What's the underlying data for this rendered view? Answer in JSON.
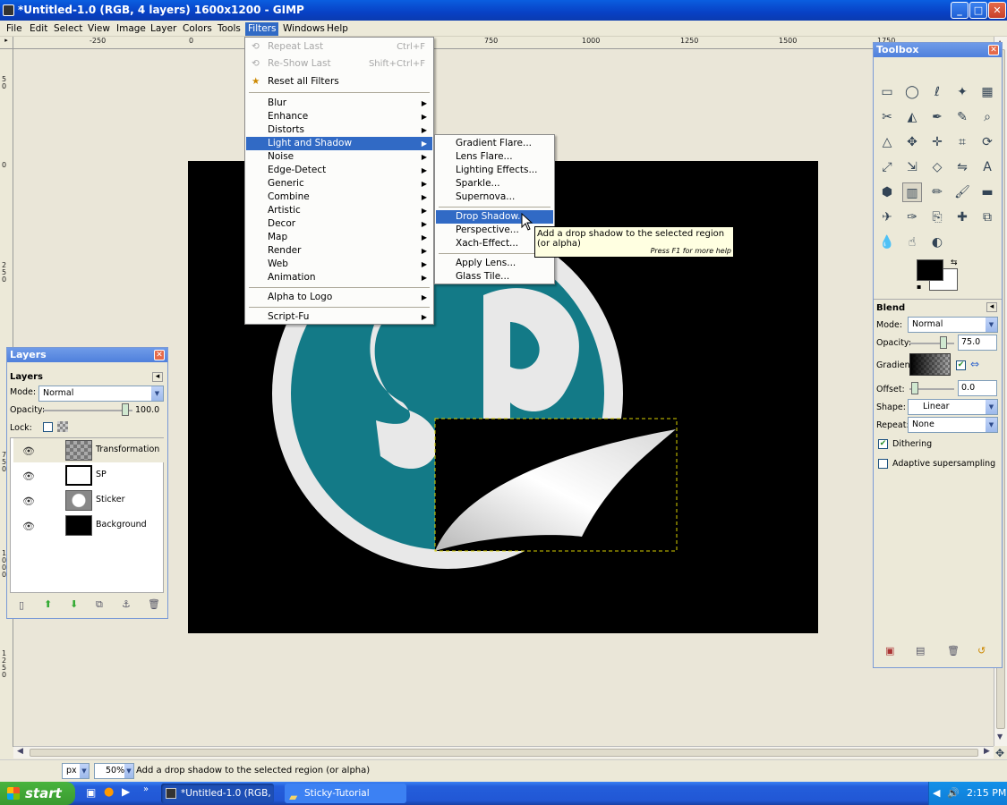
{
  "window": {
    "title": "*Untitled-1.0 (RGB, 4 layers) 1600x1200 - GIMP",
    "minimize": "_",
    "maximize": "□",
    "close": "✕"
  },
  "menubar": [
    "File",
    "Edit",
    "Select",
    "View",
    "Image",
    "Layer",
    "Colors",
    "Tools",
    "Filters",
    "Windows",
    "Help"
  ],
  "rulers": {
    "top": [
      {
        "label": "-250"
      },
      {
        "label": "0"
      },
      {
        "label": "750"
      },
      {
        "label": "1000"
      },
      {
        "label": "1250"
      },
      {
        "label": "1500"
      },
      {
        "label": "1750"
      }
    ],
    "left": [
      {
        "label": "5 0"
      },
      {
        "label": "0"
      },
      {
        "label": "2 5 0"
      },
      {
        "label": "7 5 0"
      },
      {
        "label": "1 0 0 0"
      },
      {
        "label": "1 2 5 0"
      }
    ]
  },
  "filters_menu": {
    "items": [
      {
        "label": "Repeat Last",
        "accel": "Ctrl+F",
        "disabled": true,
        "icon": "repeat-icon"
      },
      {
        "label": "Re-Show Last",
        "accel": "Shift+Ctrl+F",
        "disabled": true,
        "icon": "reshow-icon"
      },
      {
        "label": "Reset all Filters",
        "icon": "reset-icon"
      },
      {
        "label": "Blur",
        "sub": true
      },
      {
        "label": "Enhance",
        "sub": true
      },
      {
        "label": "Distorts",
        "sub": true
      },
      {
        "label": "Light and Shadow",
        "sub": true,
        "highlighted": true
      },
      {
        "label": "Noise",
        "sub": true
      },
      {
        "label": "Edge-Detect",
        "sub": true
      },
      {
        "label": "Generic",
        "sub": true
      },
      {
        "label": "Combine",
        "sub": true
      },
      {
        "label": "Artistic",
        "sub": true
      },
      {
        "label": "Decor",
        "sub": true
      },
      {
        "label": "Map",
        "sub": true
      },
      {
        "label": "Render",
        "sub": true
      },
      {
        "label": "Web",
        "sub": true
      },
      {
        "label": "Animation",
        "sub": true
      },
      {
        "label": "Alpha to Logo",
        "sub": true
      },
      {
        "label": "Script-Fu",
        "sub": true
      }
    ]
  },
  "light_shadow_menu": {
    "items": [
      {
        "label": "Gradient Flare..."
      },
      {
        "label": "Lens Flare..."
      },
      {
        "label": "Lighting Effects..."
      },
      {
        "label": "Sparkle..."
      },
      {
        "label": "Supernova..."
      },
      {
        "label": "Drop Shadow...",
        "highlighted": true
      },
      {
        "label": "Perspective..."
      },
      {
        "label": "Xach-Effect..."
      },
      {
        "label": "Apply Lens..."
      },
      {
        "label": "Glass Tile..."
      }
    ]
  },
  "tooltip": {
    "text": "Add a drop shadow to the selected region (or alpha)",
    "hint": "Press F1 for more help"
  },
  "layers_dock": {
    "title": "Layers",
    "tab_label": "Layers",
    "mode_label": "Mode:",
    "mode_value": "Normal",
    "opacity_label": "Opacity:",
    "opacity_value": "100.0",
    "lock_label": "Lock:",
    "layers": [
      {
        "name": "Transformation",
        "selected": true
      },
      {
        "name": "SP"
      },
      {
        "name": "Sticker"
      },
      {
        "name": "Background"
      }
    ],
    "buttons": [
      "new-layer-icon",
      "raise-layer-icon",
      "lower-layer-icon",
      "duplicate-layer-icon",
      "anchor-layer-icon",
      "delete-layer-icon"
    ]
  },
  "toolbox": {
    "title": "Toolbox",
    "tools": [
      "rect-select-icon",
      "ellipse-select-icon",
      "free-select-icon",
      "fuzzy-select-icon",
      "color-select-icon",
      "scissors-icon",
      "foreground-select-icon",
      "paths-icon",
      "color-picker-icon",
      "zoom-icon",
      "measure-icon",
      "move-icon",
      "align-icon",
      "crop-icon",
      "rotate-icon",
      "scale-icon",
      "shear-icon",
      "perspective-icon",
      "flip-icon",
      "text-icon",
      "bucket-fill-icon",
      "blend-icon",
      "pencil-icon",
      "paintbrush-icon",
      "eraser-icon",
      "airbrush-icon",
      "ink-icon",
      "clone-icon",
      "heal-icon",
      "perspective-clone-icon",
      "blur-icon",
      "smudge-icon",
      "dodge-burn-icon"
    ],
    "tool_glyphs": [
      "▭",
      "◯",
      "ℓ",
      "✦",
      "▦",
      "✂",
      "◭",
      "✒",
      "✎",
      "⌕",
      "△",
      "✥",
      "✛",
      "⌗",
      "⟳",
      "⤢",
      "⇲",
      "◇",
      "⇋",
      "A",
      "⬢",
      "▥",
      "✏",
      "🖌",
      "▬",
      "✈",
      "✑",
      "⎘",
      "✚",
      "⧉",
      "💧",
      "☝",
      "◐"
    ],
    "options_title": "Blend",
    "mode_label": "Mode:",
    "mode_value": "Normal",
    "opacity_label": "Opacity:",
    "opacity_value": "75.0",
    "gradient_label": "Gradient:",
    "offset_label": "Offset:",
    "offset_value": "0.0",
    "shape_label": "Shape:",
    "shape_value": "Linear",
    "repeat_label": "Repeat:",
    "repeat_value": "None",
    "dithering_label": "Dithering",
    "dithering_checked": true,
    "adaptive_label": "Adaptive supersampling",
    "adaptive_checked": false
  },
  "statusbar": {
    "unit": "px",
    "zoom": "50%",
    "message": "Add a drop shadow to the selected region (or alpha)"
  },
  "taskbar": {
    "start": "start",
    "tasks": [
      {
        "label": "*Untitled-1.0 (RGB, 4...",
        "active": true
      },
      {
        "label": "Sticky-Tutorial"
      }
    ],
    "clock": "2:15 PM"
  },
  "colors": {
    "teal": "#137a87",
    "menu_highlight": "#316ac5",
    "xp_blue": "#245edb"
  }
}
